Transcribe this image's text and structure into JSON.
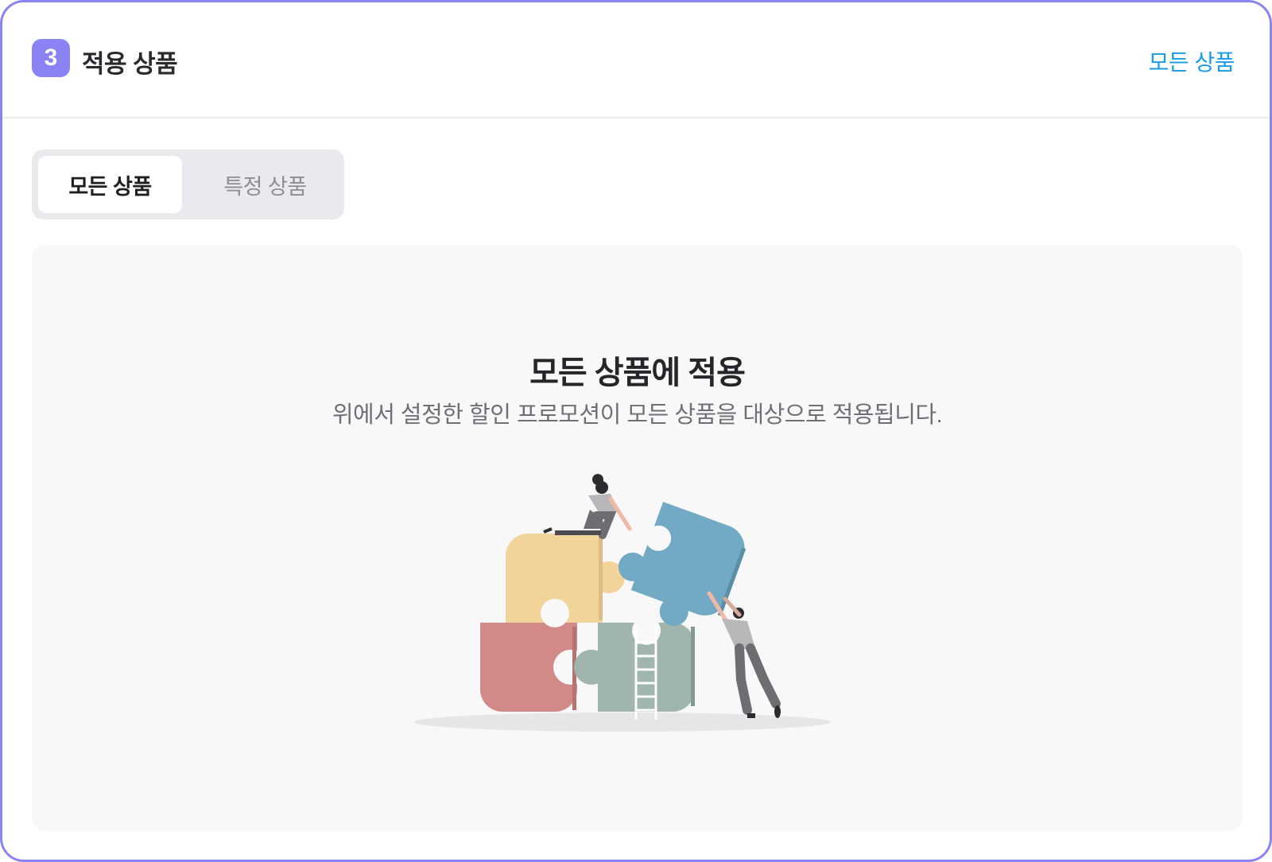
{
  "header": {
    "step_number": "3",
    "title": "적용 상품",
    "link_label": "모든 상품"
  },
  "segmented_control": {
    "options": [
      {
        "label": "모든 상품",
        "selected": true
      },
      {
        "label": "특정 상품",
        "selected": false
      }
    ]
  },
  "panel": {
    "title": "모든 상품에 적용",
    "description": "위에서 설정한 할인 프로모션이 모든 상품을 대상으로 적용됩니다.",
    "illustration": "puzzle-teamwork-illustration"
  },
  "colors": {
    "accent": "#8a83f4",
    "link": "#1a9be6",
    "segment_bg": "#e9eaee",
    "panel_bg": "#f8f8f9"
  }
}
